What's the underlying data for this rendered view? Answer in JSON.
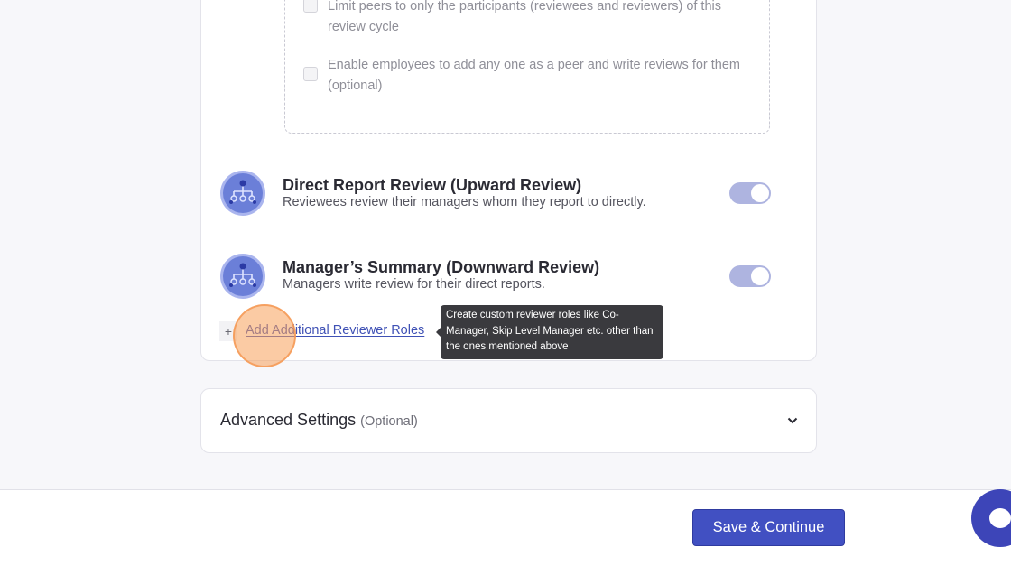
{
  "peer_options": [
    {
      "label": "Limit peers to only the participants (reviewees and reviewers) of this review cycle",
      "checked": false
    },
    {
      "label": "Enable employees to add any one as a peer and write reviews for them (optional)",
      "checked": false
    }
  ],
  "roles": [
    {
      "title": "Direct Report Review (Upward Review)",
      "description": "Reviewees review their managers whom they report to directly.",
      "enabled": true
    },
    {
      "title": "Manager’s Summary (Downward Review)",
      "description": "Managers write review for their direct reports.",
      "enabled": true
    }
  ],
  "add_roles": {
    "plus": "+",
    "label": "Add Additional Reviewer Roles",
    "tooltip": "Create custom reviewer roles like Co-Manager, Skip Level Manager etc. other than the ones mentioned above"
  },
  "advanced": {
    "title": "Advanced Settings",
    "optional": "(Optional)"
  },
  "footer": {
    "save_label": "Save & Continue"
  },
  "colors": {
    "accent": "#4150c2",
    "toggle_on": "#aeb4e0",
    "highlight": "#f7a05a",
    "tooltip_bg": "#3a3a3e"
  },
  "icons": {
    "role": "org-chart-icon",
    "expand": "chevron-down-icon",
    "chat": "chat-bubble-icon"
  }
}
